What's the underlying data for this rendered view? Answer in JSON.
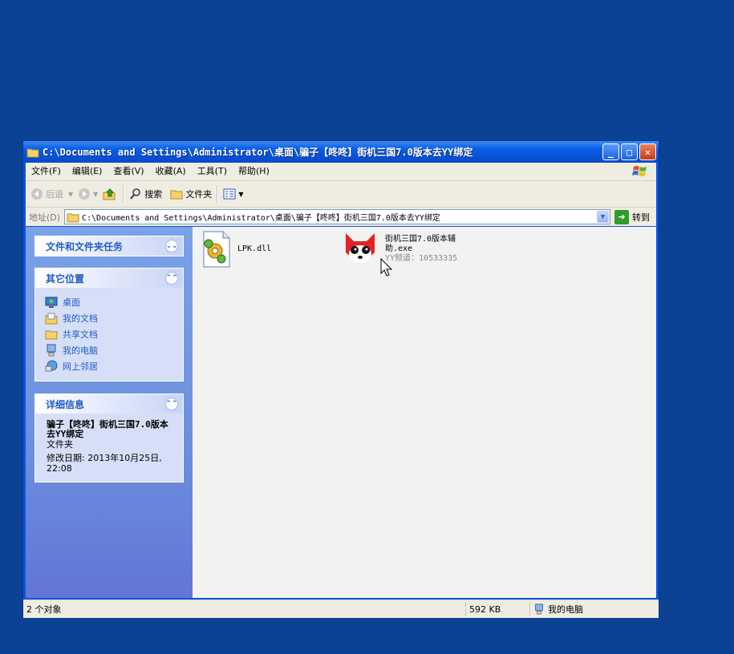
{
  "window": {
    "title": "C:\\Documents and Settings\\Administrator\\桌面\\骗子【咚咚】街机三国7.0版本去YY绑定"
  },
  "menu": [
    "文件(F)",
    "编辑(E)",
    "查看(V)",
    "收藏(A)",
    "工具(T)",
    "帮助(H)"
  ],
  "toolbar": {
    "back": "后退",
    "search": "搜索",
    "folders": "文件夹"
  },
  "address": {
    "label": "地址(D)",
    "value": "C:\\Documents and Settings\\Administrator\\桌面\\骗子【咚咚】街机三国7.0版本去YY绑定",
    "go": "转到"
  },
  "sidebar": {
    "tasks_title": "文件和文件夹任务",
    "other_title": "其它位置",
    "other_items": [
      {
        "label": "桌面",
        "icon": "desktop-icon"
      },
      {
        "label": "我的文档",
        "icon": "my-documents-icon"
      },
      {
        "label": "共享文档",
        "icon": "shared-documents-icon"
      },
      {
        "label": "我的电脑",
        "icon": "my-computer-icon"
      },
      {
        "label": "网上邻居",
        "icon": "network-places-icon"
      }
    ],
    "details_title": "详细信息",
    "details_name": "骗子【咚咚】街机三国7.0版本去YY绑定",
    "details_type": "文件夹",
    "details_modified": "修改日期: 2013年10月25日, 22:08"
  },
  "files": [
    {
      "name": "LPK.dll",
      "icon": "dll-gear-icon"
    },
    {
      "name_line1": "街机三国7.0版本辅",
      "name_line2": "助.exe",
      "sub": "YY频道：10533335",
      "icon": "red-fox-icon"
    }
  ],
  "status": {
    "count": "2 个对象",
    "size": "592 KB",
    "location": "我的电脑"
  },
  "colors": {
    "desktop": "#0c4293",
    "titlebar": "#0a5fe8",
    "link": "#215dc6"
  }
}
